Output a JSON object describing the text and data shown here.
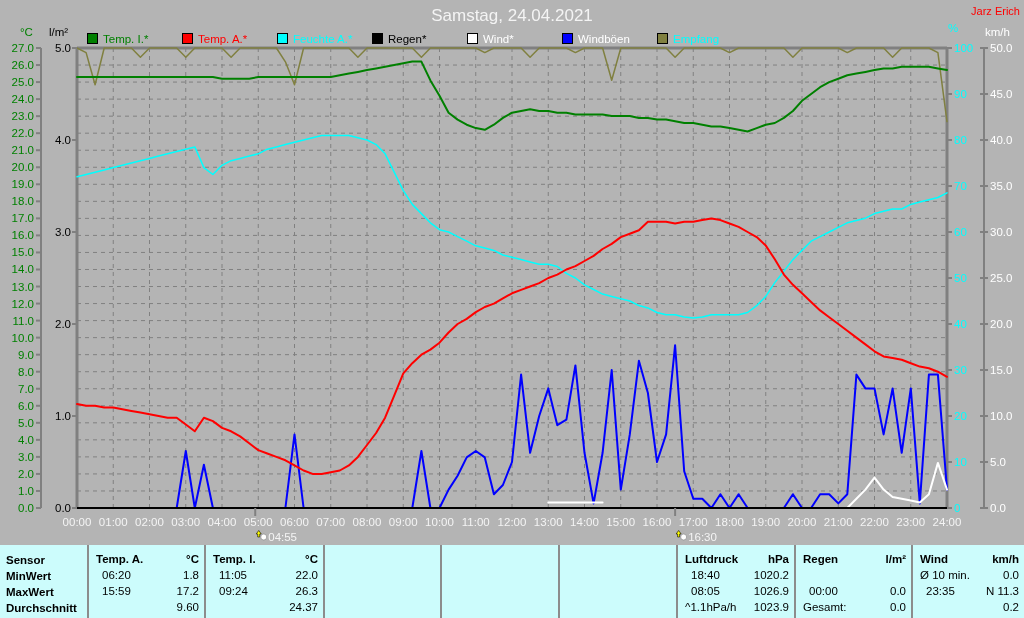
{
  "title": "Samstag, 24.04.2021",
  "author": "Jarz Erich",
  "rain_axis": {
    "unit": "l/m²",
    "ticks": [
      "5.0",
      "4.0",
      "3.0",
      "2.0",
      "1.0",
      "0.0"
    ]
  },
  "chart_data": {
    "type": "line",
    "grid": true,
    "legend": "top",
    "xlim": [
      0,
      24
    ],
    "x": [
      0,
      0.25,
      0.5,
      0.75,
      1,
      1.25,
      1.5,
      1.75,
      2,
      2.25,
      2.5,
      2.75,
      3,
      3.25,
      3.5,
      3.75,
      4,
      4.25,
      4.5,
      4.75,
      5,
      5.25,
      5.5,
      5.75,
      6,
      6.25,
      6.5,
      6.75,
      7,
      7.25,
      7.5,
      7.75,
      8,
      8.25,
      8.5,
      8.75,
      9,
      9.25,
      9.5,
      9.75,
      10,
      10.25,
      10.5,
      10.75,
      11,
      11.25,
      11.5,
      11.75,
      12,
      12.25,
      12.5,
      12.75,
      13,
      13.25,
      13.5,
      13.75,
      14,
      14.25,
      14.5,
      14.75,
      15,
      15.25,
      15.5,
      15.75,
      16,
      16.25,
      16.5,
      16.75,
      17,
      17.25,
      17.5,
      17.75,
      18,
      18.25,
      18.5,
      18.75,
      19,
      19.25,
      19.5,
      19.75,
      20,
      20.25,
      20.5,
      20.75,
      21,
      21.25,
      21.5,
      21.75,
      22,
      22.25,
      22.5,
      22.75,
      23,
      23.25,
      23.5,
      23.75,
      24
    ],
    "xticks": [
      {
        "value": 0,
        "label": "00:00"
      },
      {
        "value": 1,
        "label": "01:00"
      },
      {
        "value": 2,
        "label": "02:00"
      },
      {
        "value": 3,
        "label": "03:00"
      },
      {
        "value": 4,
        "label": "04:00"
      },
      {
        "value": 5,
        "label": "05:00"
      },
      {
        "value": 6,
        "label": "06:00"
      },
      {
        "value": 7,
        "label": "07:00"
      },
      {
        "value": 8,
        "label": "08:00"
      },
      {
        "value": 9,
        "label": "09:00"
      },
      {
        "value": 10,
        "label": "10:00"
      },
      {
        "value": 11,
        "label": "11:00"
      },
      {
        "value": 12,
        "label": "12:00"
      },
      {
        "value": 13,
        "label": "13:00"
      },
      {
        "value": 14,
        "label": "14:00"
      },
      {
        "value": 15,
        "label": "15:00"
      },
      {
        "value": 16,
        "label": "16:00"
      },
      {
        "value": 17,
        "label": "17:00"
      },
      {
        "value": 18,
        "label": "18:00"
      },
      {
        "value": 19,
        "label": "19:00"
      },
      {
        "value": 20,
        "label": "20:00"
      },
      {
        "value": 21,
        "label": "21:00"
      },
      {
        "value": 22,
        "label": "22:00"
      },
      {
        "value": 23,
        "label": "23:00"
      },
      {
        "value": 24,
        "label": "24:00"
      }
    ],
    "ylabel": "°C",
    "ylim": [
      0,
      27
    ],
    "yticks": [
      {
        "value": 0,
        "label": "0.0"
      },
      {
        "value": 1,
        "label": "1.0"
      },
      {
        "value": 2,
        "label": "2.0"
      },
      {
        "value": 3,
        "label": "3.0"
      },
      {
        "value": 4,
        "label": "4.0"
      },
      {
        "value": 5,
        "label": "5.0"
      },
      {
        "value": 6,
        "label": "6.0"
      },
      {
        "value": 7,
        "label": "7.0"
      },
      {
        "value": 8,
        "label": "8.0"
      },
      {
        "value": 9,
        "label": "9.0"
      },
      {
        "value": 10,
        "label": "10.0"
      },
      {
        "value": 11,
        "label": "11.0"
      },
      {
        "value": 12,
        "label": "12.0"
      },
      {
        "value": 13,
        "label": "13.0"
      },
      {
        "value": 14,
        "label": "14.0"
      },
      {
        "value": 15,
        "label": "15.0"
      },
      {
        "value": 16,
        "label": "16.0"
      },
      {
        "value": 17,
        "label": "17.0"
      },
      {
        "value": 18,
        "label": "18.0"
      },
      {
        "value": 19,
        "label": "19.0"
      },
      {
        "value": 20,
        "label": "20.0"
      },
      {
        "value": 21,
        "label": "21.0"
      },
      {
        "value": 22,
        "label": "22.0"
      },
      {
        "value": 23,
        "label": "23.0"
      },
      {
        "value": 24,
        "label": "24.0"
      },
      {
        "value": 25,
        "label": "25.0"
      },
      {
        "value": 26,
        "label": "26.0"
      },
      {
        "value": 27,
        "label": "27.0"
      }
    ],
    "y2label": "%",
    "y2lim": [
      0,
      100
    ],
    "y2ticks": [
      0,
      10,
      20,
      30,
      40,
      50,
      60,
      70,
      80,
      90,
      100
    ],
    "y3label": "km/h",
    "y3lim": [
      0,
      50
    ],
    "y3ticks": [
      {
        "value": 0,
        "label": "0.0"
      },
      {
        "value": 5,
        "label": "5.0"
      },
      {
        "value": 10,
        "label": "10.0"
      },
      {
        "value": 15,
        "label": "15.0"
      },
      {
        "value": 20,
        "label": "20.0"
      },
      {
        "value": 25,
        "label": "25.0"
      },
      {
        "value": 30,
        "label": "30.0"
      },
      {
        "value": 35,
        "label": "35.0"
      },
      {
        "value": 40,
        "label": "40.0"
      },
      {
        "value": 45,
        "label": "45.0"
      },
      {
        "value": 50,
        "label": "50.0"
      }
    ],
    "series": [
      {
        "name": "Temp. I.*",
        "color": "#008000",
        "values": [
          25.3,
          25.3,
          25.3,
          25.3,
          25.3,
          25.3,
          25.3,
          25.3,
          25.3,
          25.3,
          25.3,
          25.3,
          25.3,
          25.3,
          25.3,
          25.3,
          25.2,
          25.2,
          25.2,
          25.2,
          25.3,
          25.3,
          25.3,
          25.3,
          25.3,
          25.3,
          25.3,
          25.3,
          25.3,
          25.4,
          25.5,
          25.6,
          25.7,
          25.8,
          25.9,
          26.0,
          26.1,
          26.2,
          26.2,
          25.1,
          24.2,
          23.2,
          22.8,
          22.5,
          22.3,
          22.2,
          22.5,
          22.9,
          23.2,
          23.3,
          23.4,
          23.3,
          23.3,
          23.2,
          23.2,
          23.1,
          23.1,
          23.1,
          23.1,
          23.0,
          23.0,
          23.0,
          22.9,
          22.9,
          22.8,
          22.8,
          22.7,
          22.6,
          22.6,
          22.5,
          22.4,
          22.4,
          22.3,
          22.2,
          22.1,
          22.3,
          22.5,
          22.6,
          22.9,
          23.3,
          23.9,
          24.3,
          24.7,
          25.0,
          25.2,
          25.4,
          25.5,
          25.6,
          25.7,
          25.8,
          25.8,
          25.9,
          25.9,
          25.9,
          25.9,
          25.8,
          25.7
        ]
      },
      {
        "name": "Temp. A.*",
        "color": "#ff0000",
        "values": [
          6.1,
          6.0,
          6.0,
          5.9,
          5.9,
          5.8,
          5.7,
          5.6,
          5.5,
          5.4,
          5.3,
          5.3,
          4.9,
          4.5,
          5.3,
          5.1,
          4.7,
          4.5,
          4.2,
          3.8,
          3.4,
          3.2,
          3.0,
          2.8,
          2.5,
          2.2,
          2.0,
          2.0,
          2.1,
          2.2,
          2.5,
          3.0,
          3.7,
          4.4,
          5.3,
          6.6,
          7.9,
          8.5,
          9.0,
          9.3,
          9.7,
          10.3,
          10.8,
          11.1,
          11.5,
          11.8,
          12.0,
          12.3,
          12.6,
          12.8,
          13.0,
          13.2,
          13.5,
          13.7,
          14.0,
          14.2,
          14.5,
          14.8,
          15.2,
          15.5,
          15.9,
          16.1,
          16.3,
          16.8,
          16.8,
          16.8,
          16.7,
          16.8,
          16.8,
          16.9,
          17.0,
          16.9,
          16.7,
          16.5,
          16.2,
          15.9,
          15.4,
          14.6,
          13.7,
          13.1,
          12.6,
          12.1,
          11.6,
          11.2,
          10.8,
          10.4,
          10.0,
          9.6,
          9.2,
          8.9,
          8.8,
          8.7,
          8.5,
          8.3,
          8.2,
          8.0,
          7.7
        ]
      },
      {
        "name": "Feuchte A.*",
        "color": "#00ffff",
        "axis": "y2",
        "values": [
          72,
          72.5,
          73,
          73.5,
          74,
          74.5,
          75,
          75.5,
          76,
          76.5,
          77,
          77.5,
          78,
          78.5,
          74,
          72.5,
          74.5,
          75.5,
          76,
          76.5,
          77,
          78,
          78.5,
          79,
          79.5,
          80,
          80.5,
          81,
          81,
          81,
          81,
          80.5,
          80,
          79,
          77,
          73,
          69,
          66,
          64,
          62,
          60.5,
          60,
          59,
          58,
          57,
          56.5,
          56,
          55,
          54.5,
          54,
          53.5,
          53,
          53,
          52.5,
          51,
          50,
          48.5,
          47.5,
          46.5,
          46,
          45.5,
          45,
          44,
          43.5,
          42.5,
          42,
          42,
          41.5,
          41.3,
          41.5,
          42,
          42,
          42,
          42,
          42.5,
          44,
          46,
          49,
          51.5,
          54,
          56,
          58,
          59,
          60,
          61,
          62,
          62.5,
          63,
          64,
          64.5,
          65,
          65,
          66,
          66.5,
          67,
          67.5,
          68.5
        ]
      },
      {
        "name": "Regen*",
        "color": "#000000",
        "values": [
          0,
          0,
          0,
          0,
          0,
          0,
          0,
          0,
          0,
          0,
          0,
          0,
          0,
          0,
          0,
          0,
          0,
          0,
          0,
          0,
          0,
          0,
          0,
          0,
          0,
          0,
          0,
          0,
          0,
          0,
          0,
          0,
          0,
          0,
          0,
          0,
          0,
          0,
          0,
          0,
          0,
          0,
          0,
          0,
          0,
          0,
          0,
          0,
          0,
          0,
          0,
          0,
          0,
          0,
          0,
          0,
          0,
          0,
          0,
          0,
          0,
          0,
          0,
          0,
          0,
          0,
          0,
          0,
          0,
          0,
          0,
          0,
          0,
          0,
          0,
          0,
          0,
          0,
          0,
          0,
          0,
          0,
          0,
          0,
          0,
          0,
          0,
          0,
          0,
          0,
          0,
          0,
          0,
          0,
          0,
          0,
          0
        ]
      },
      {
        "name": "Wind*",
        "color": "#ffffff",
        "axis": "y3",
        "values": [
          null,
          null,
          null,
          null,
          null,
          null,
          null,
          null,
          null,
          null,
          null,
          null,
          null,
          null,
          null,
          null,
          null,
          null,
          null,
          null,
          null,
          null,
          null,
          null,
          null,
          null,
          null,
          null,
          null,
          null,
          null,
          null,
          null,
          null,
          null,
          null,
          null,
          null,
          null,
          null,
          null,
          null,
          null,
          null,
          null,
          null,
          null,
          null,
          null,
          null,
          null,
          null,
          0.6,
          0.6,
          0.6,
          0.6,
          0.6,
          0.6,
          0.6,
          null,
          null,
          null,
          null,
          null,
          null,
          null,
          null,
          null,
          null,
          null,
          null,
          null,
          null,
          null,
          null,
          null,
          null,
          null,
          null,
          null,
          null,
          null,
          null,
          null,
          null,
          0,
          1.0,
          2.0,
          3.3,
          2.0,
          1.2,
          1.0,
          0.8,
          0.6,
          1.5,
          4.9,
          2.0
        ]
      },
      {
        "name": "Windböen",
        "color": "#0000ff",
        "axis": "y3",
        "values": [
          null,
          null,
          null,
          null,
          null,
          null,
          null,
          null,
          null,
          null,
          null,
          0,
          6.2,
          0,
          4.7,
          0,
          null,
          null,
          null,
          null,
          null,
          null,
          null,
          0,
          8.0,
          0,
          null,
          null,
          null,
          null,
          null,
          null,
          null,
          null,
          null,
          null,
          null,
          0,
          6.2,
          0,
          0,
          2.0,
          3.5,
          5.5,
          6.2,
          5.5,
          1.5,
          2.5,
          5.0,
          14.5,
          6.0,
          10.0,
          13.0,
          9.0,
          9.6,
          15.5,
          6.0,
          0.5,
          6.0,
          15.0,
          2.0,
          8.0,
          16.0,
          12.5,
          5.0,
          8.0,
          17.7,
          4.0,
          1.0,
          1.0,
          0,
          1.5,
          0,
          1.5,
          0,
          null,
          null,
          null,
          0,
          1.5,
          0,
          0,
          1.5,
          1.5,
          0.5,
          1.5,
          14.5,
          13.0,
          13.0,
          8.0,
          13.0,
          6.0,
          13.0,
          0.5,
          14.5,
          14.5,
          2.0
        ]
      },
      {
        "name": "Empfang",
        "color": "#808040",
        "axis": "y2",
        "values": [
          100,
          99,
          92,
          100,
          100,
          100,
          100,
          98,
          100,
          100,
          100,
          100,
          98,
          100,
          100,
          100,
          100,
          98,
          100,
          100,
          100,
          100,
          100,
          97,
          92,
          100,
          100,
          100,
          100,
          100,
          100,
          98,
          100,
          100,
          100,
          100,
          100,
          100,
          98,
          100,
          100,
          100,
          100,
          100,
          100,
          99,
          100,
          100,
          100,
          100,
          98,
          100,
          100,
          100,
          100,
          99,
          100,
          100,
          100,
          93,
          100,
          100,
          100,
          100,
          100,
          100,
          98,
          100,
          100,
          100,
          100,
          100,
          99,
          100,
          100,
          100,
          100,
          100,
          100,
          98,
          100,
          100,
          100,
          100,
          100,
          99,
          100,
          100,
          100,
          100,
          98,
          100,
          100,
          100,
          100,
          99,
          84
        ]
      }
    ],
    "annotations": [
      "04:55",
      "16:30"
    ]
  },
  "stats": {
    "header": "Sensor",
    "row_labels": [
      "MinWert",
      "MaxWert",
      "Durchschnitt"
    ],
    "columns": [
      {
        "kind": "sensor",
        "title": "Temp. A.",
        "unit": "°C",
        "rows": [
          {
            "time": "06:20",
            "value": "1.8"
          },
          {
            "time": "15:59",
            "value": "17.2"
          },
          {
            "value": "9.60"
          }
        ]
      },
      {
        "kind": "sensor",
        "title": "Temp. I.",
        "unit": "°C",
        "rows": [
          {
            "time": "11:05",
            "value": "22.0"
          },
          {
            "time": "09:24",
            "value": "26.3"
          },
          {
            "value": "24.37"
          }
        ]
      },
      {
        "kind": "blank"
      },
      {
        "kind": "blank"
      },
      {
        "kind": "blank"
      },
      {
        "kind": "sensor",
        "title": "Luftdruck",
        "unit": "hPa",
        "rows": [
          {
            "time": "18:40",
            "value": "1020.2"
          },
          {
            "time": "08:05",
            "value": "1026.9"
          },
          {
            "label": "^1.1hPa/h",
            "value": "1023.9"
          }
        ]
      },
      {
        "kind": "sensor",
        "title": "Regen",
        "unit": "l/m²",
        "rows": [
          {},
          {
            "time": "00:00",
            "value": "0.0"
          },
          {
            "label": "Gesamt:",
            "value": "0.0"
          }
        ]
      },
      {
        "kind": "sensor",
        "title": "Wind",
        "unit": "km/h",
        "rows": [
          {
            "label": "Ø 10 min.",
            "value": "0.0"
          },
          {
            "time": "23:35",
            "value": "N 11.3"
          },
          {
            "value": "0.2"
          }
        ]
      }
    ]
  }
}
